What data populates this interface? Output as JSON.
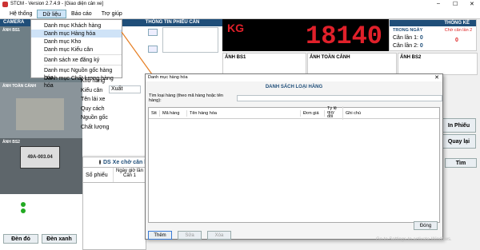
{
  "window": {
    "title": "STCM - Version 2.7.4.9 - [Giao diện cân xe]",
    "min": "–",
    "max": "☐",
    "close": "✕"
  },
  "menubar": [
    "Hệ thống",
    "Dữ liệu",
    "Báo cáo",
    "Trợ giúp"
  ],
  "dropdown": {
    "items": [
      "Danh mục Khách hàng",
      "Danh mục Hàng hóa",
      "Danh mục Kho",
      "Danh mục Kiểu cân",
      "Danh sách xe đăng ký",
      "Danh mục Nguồn gốc hàng hóa",
      "Danh mục Chất lượng hàng hóa"
    ]
  },
  "camera": {
    "header": "CAMERA",
    "bs1": "ẢNH BS1",
    "toan_canh": "ẢNH TOÀN CẢNH",
    "bs2": "ẢNH BS2",
    "plate": "49A-003.04",
    "btn_red": "Đèn đỏ",
    "btn_green": "Đèn xanh"
  },
  "ticket": {
    "header": "THÔNG TIN PHIẾU CÂN",
    "labels": [
      "Kho hàng",
      "Kiểu cân",
      "Tên lái xe",
      "Quy cách",
      "Nguồn gốc",
      "Chất lượng"
    ],
    "kieu_can_value": "Xuất",
    "ellipsis": "..."
  },
  "scale": {
    "unit": "KG",
    "value": "18140"
  },
  "stats": {
    "header": "THỐNG KÊ",
    "today": "TRONG NGÀY",
    "can1_label": "Cân lần 1:",
    "can1": "0",
    "can2_label": "Cân lần 2:",
    "can2": "0",
    "pending_label": "Chờ cân lần 2",
    "pending": "0"
  },
  "photos": {
    "bs1": "ẢNH BS1",
    "toan_canh": "ẢNH TOÀN CẢNH",
    "bs2": "ẢNH BS2"
  },
  "actions": {
    "print": "In Phiếu",
    "back": "Quay lại",
    "search": "Tìm"
  },
  "waiting": {
    "title": "DS Xe chờ cân lần 2",
    "columns": [
      "Số phiếu",
      "Ngày giờ lần Cân 1"
    ]
  },
  "dialog": {
    "title": "Danh mục hàng hóa",
    "heading": "DANH SÁCH LOẠI HÀNG",
    "search_label": "Tìm loại hàng (theo mã hàng hoặc tên hàng):",
    "search_value": "",
    "columns": [
      "Stt",
      "Mã hàng",
      "Tên hàng hóa",
      "Đơn giá",
      "Tỷ lệ quy đổi",
      "Ghi chú"
    ],
    "buttons": {
      "add": "Thêm",
      "edit": "Sửa",
      "delete": "Xóa",
      "close": "Đóng"
    }
  },
  "watermark": "Go to Settings to activate Windows."
}
